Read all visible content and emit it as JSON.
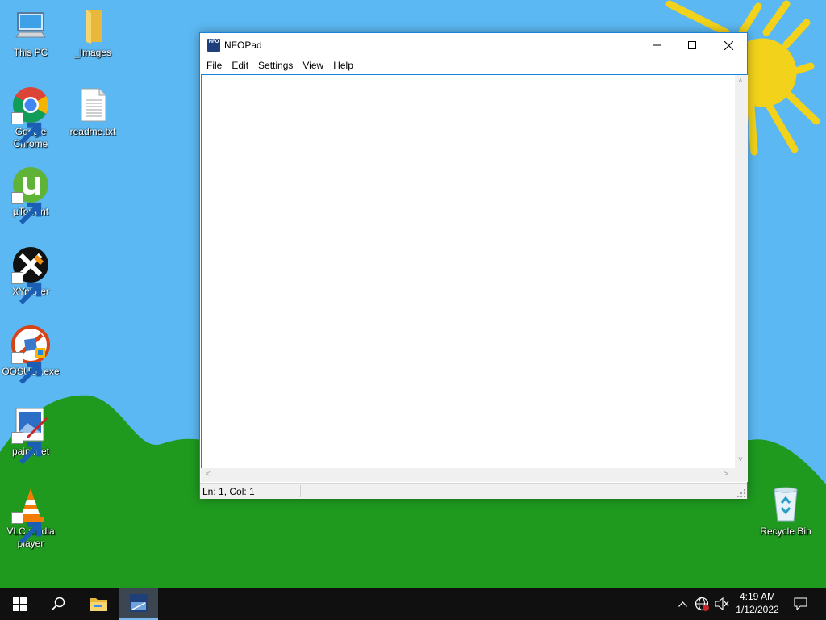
{
  "desktop": {
    "icons": [
      {
        "label": "This PC",
        "icon": "computer-icon"
      },
      {
        "label": "_Images",
        "icon": "folder-icon"
      },
      {
        "label": "Google Chrome",
        "icon": "chrome-icon"
      },
      {
        "label": "readme.txt",
        "icon": "text-file-icon"
      },
      {
        "label": "µTorrent",
        "icon": "utorrent-icon"
      },
      {
        "label": "XYplorer",
        "icon": "xyplorer-icon"
      },
      {
        "label": "OOSU10.exe",
        "icon": "oosu10-icon"
      },
      {
        "label": "paint.net",
        "icon": "paintnet-icon"
      },
      {
        "label": "VLC media player",
        "icon": "vlc-icon"
      },
      {
        "label": "Recycle Bin",
        "icon": "recycle-bin-icon"
      }
    ]
  },
  "window": {
    "app_icon_text": "NFO",
    "title": "NFOPad",
    "menu": [
      "File",
      "Edit",
      "Settings",
      "View",
      "Help"
    ],
    "editor_text": "",
    "status": "Ln: 1, Col: 1"
  },
  "taskbar": {
    "time": "4:19 AM",
    "date": "1/12/2022"
  },
  "colors": {
    "sky": "#5cb8f2",
    "grass": "#1f9a1f",
    "sun": "#f2d21a",
    "accent": "#1883d7",
    "taskbar": "#101010"
  }
}
